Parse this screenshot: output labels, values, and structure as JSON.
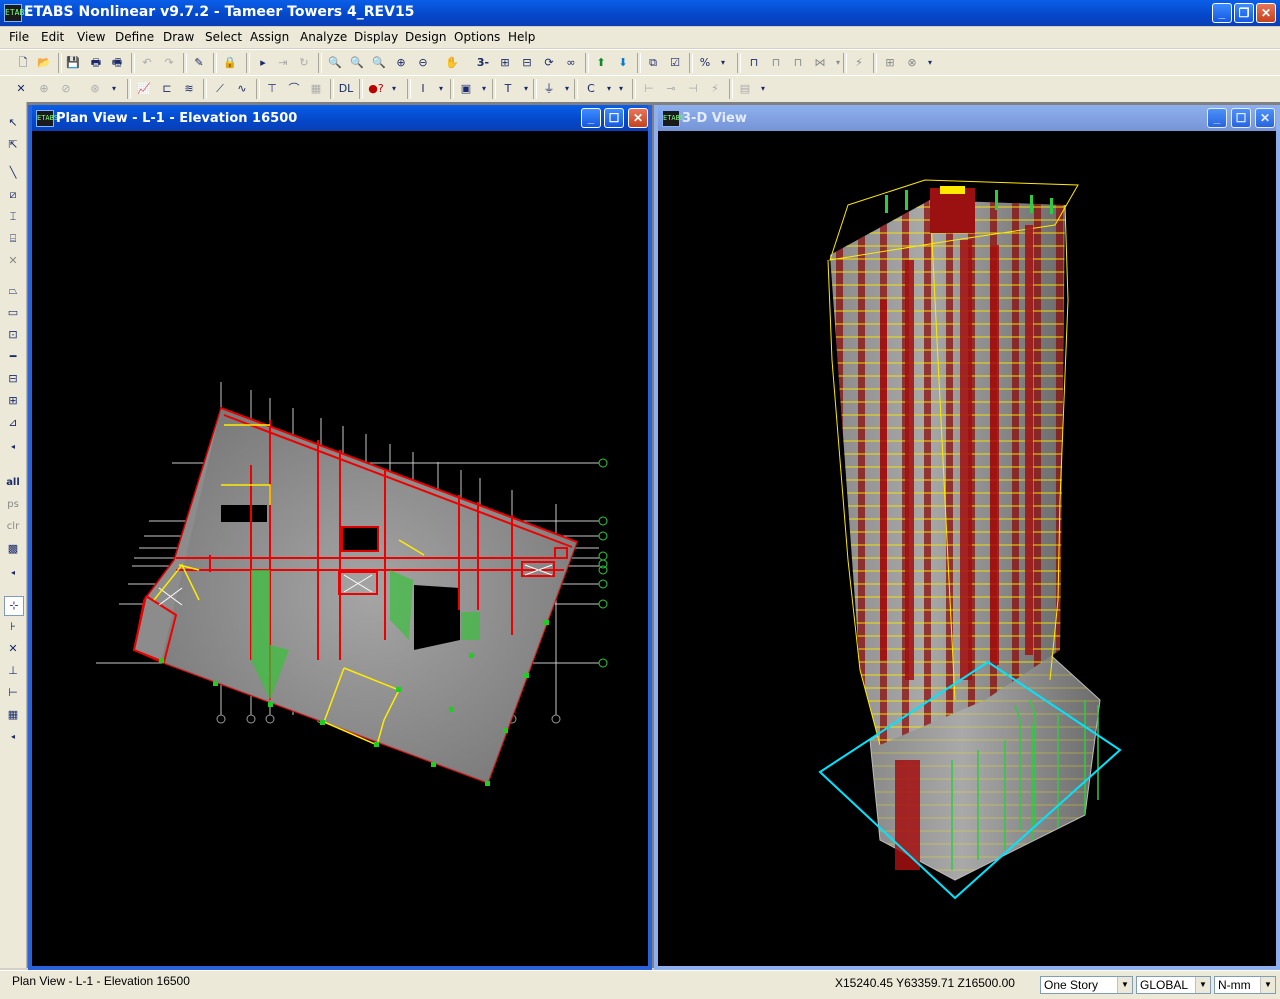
{
  "app": {
    "title": "ETABS Nonlinear v9.7.2 - Tameer Towers 4_REV15",
    "icon": "etabs-app-icon"
  },
  "menu": [
    "File",
    "Edit",
    "View",
    "Define",
    "Draw",
    "Select",
    "Assign",
    "Analyze",
    "Display",
    "Design",
    "Options",
    "Help"
  ],
  "toolbar1": {
    "three_d_label": "3-d"
  },
  "lefttoolbar": {
    "all_label": "all",
    "ps_label": "ps",
    "clr_label": "clr"
  },
  "windows": {
    "plan": {
      "title": "Plan View - L-1 - Elevation 16500"
    },
    "threed": {
      "title": "3-D View"
    }
  },
  "status": {
    "left": "Plan View - L-1 - Elevation 16500",
    "coords": "X15240.45  Y63359.71  Z16500.00",
    "story_select": "One Story",
    "coord_system": "GLOBAL",
    "units": "N-mm"
  }
}
